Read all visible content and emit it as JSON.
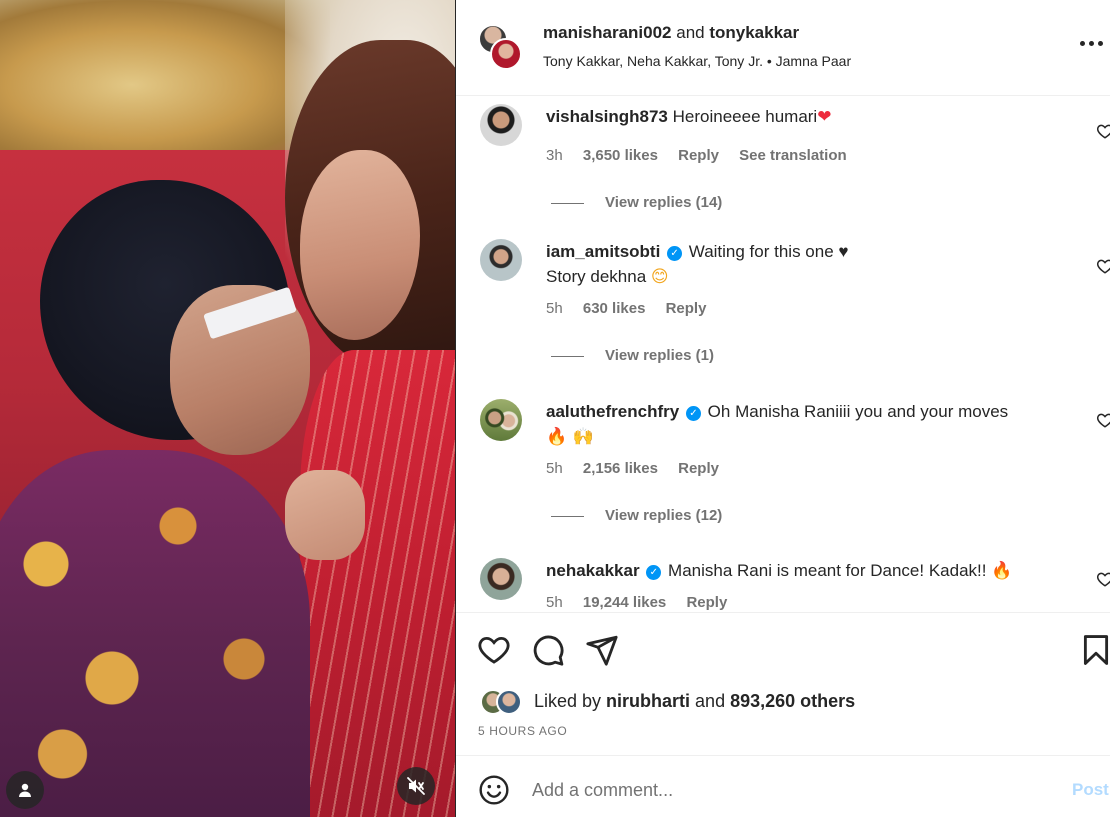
{
  "header": {
    "user1": "manisharani002",
    "and_text": " and ",
    "user2": "tonykakkar",
    "audio": "Tony Kakkar, Neha Kakkar, Tony Jr. • Jamna Paar"
  },
  "comments": [
    {
      "username": "vishalsingh873",
      "verified": false,
      "text": "Heroineeee humari",
      "emoji": "❤",
      "time": "3h",
      "likes": "3,650 likes",
      "reply": "Reply",
      "translate": "See translation",
      "view_replies": "View replies (14)"
    },
    {
      "username": "iam_amitsobti",
      "verified": true,
      "text": "Waiting for this one ♥",
      "text2": "Story dekhna",
      "emoji": "😊",
      "time": "5h",
      "likes": "630 likes",
      "reply": "Reply",
      "view_replies": "View replies (1)"
    },
    {
      "username": "aaluthefrenchfry",
      "verified": true,
      "text": "Oh Manisha Raniiii you and your moves",
      "emoji_line": "🔥 🙌",
      "time": "5h",
      "likes": "2,156 likes",
      "reply": "Reply",
      "view_replies": "View replies (12)"
    },
    {
      "username": "nehakakkar",
      "verified": true,
      "text": "Manisha Rani is meant for Dance! Kadak!!",
      "emoji": "🔥",
      "time": "5h",
      "likes": "19,244 likes",
      "reply": "Reply"
    }
  ],
  "liked_by": {
    "prefix": "Liked by ",
    "user": "nirubharti",
    "middle": " and ",
    "others": "893,260 others"
  },
  "time_ago": "5 HOURS AGO",
  "add_comment": {
    "placeholder": "Add a comment...",
    "post_label": "Post"
  },
  "icons": {
    "like": "heart-outline-icon",
    "comment": "speech-bubble-icon",
    "share": "paper-plane-icon",
    "save": "bookmark-icon",
    "emoji": "smiley-icon",
    "mute": "speaker-muted-icon",
    "tagged_users": "user-icon",
    "more": "more-horizontal-icon"
  },
  "colors": {
    "text_primary": "#262626",
    "text_secondary": "#737373",
    "verified": "#0095f6",
    "post_disabled": "#b3dbff"
  }
}
